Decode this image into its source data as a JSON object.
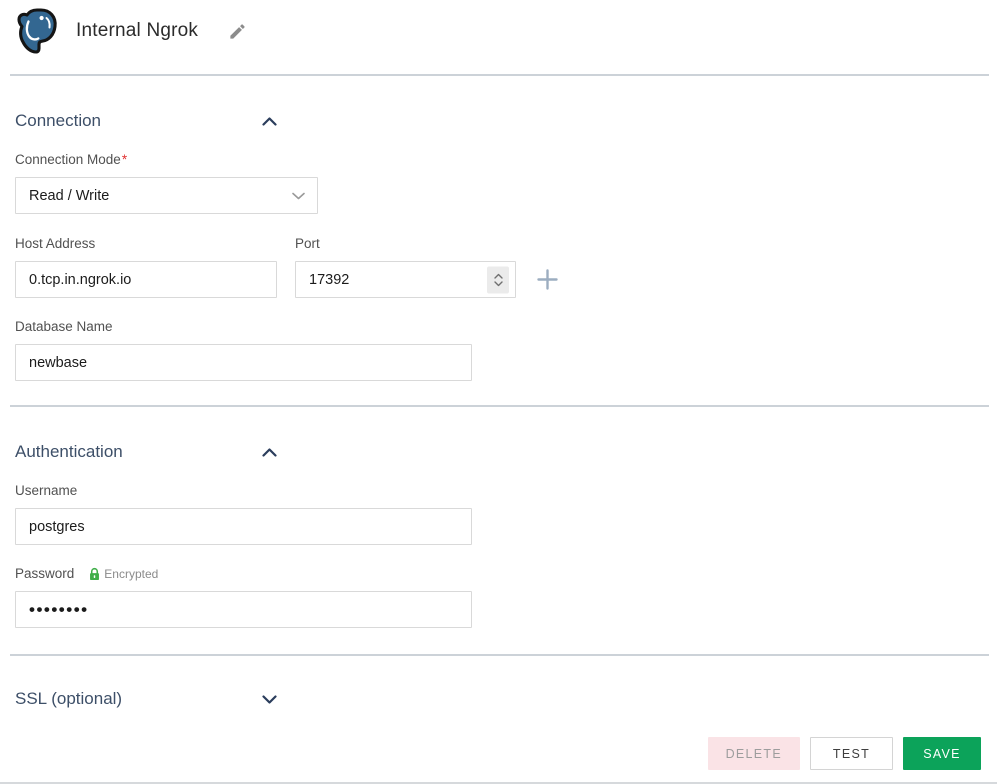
{
  "header": {
    "title": "Internal Ngrok"
  },
  "sections": {
    "connection": {
      "title": "Connection",
      "state": "expanded",
      "fields": {
        "connection_mode": {
          "label": "Connection Mode",
          "required_mark": "*",
          "value": "Read / Write"
        },
        "host_address": {
          "label": "Host Address",
          "value": "0.tcp.in.ngrok.io"
        },
        "port": {
          "label": "Port",
          "value": "17392"
        },
        "database_name": {
          "label": "Database Name",
          "value": "newbase"
        }
      }
    },
    "authentication": {
      "title": "Authentication",
      "state": "expanded",
      "fields": {
        "username": {
          "label": "Username",
          "value": "postgres"
        },
        "password": {
          "label": "Password",
          "badge": "Encrypted",
          "masked_value": "••••••••"
        }
      }
    },
    "ssl": {
      "title": "SSL (optional)",
      "state": "collapsed"
    }
  },
  "actions": {
    "delete_label": "DELETE",
    "test_label": "TEST",
    "save_label": "SAVE"
  },
  "icons": {
    "logo": "postgresql-elephant",
    "edit": "pencil-icon",
    "expanded": "chevron-up-icon",
    "collapsed": "chevron-down-icon",
    "add": "plus-icon",
    "encrypted": "lock-icon"
  },
  "colors": {
    "postgres_blue": "#336791",
    "section_heading": "#3d4f68",
    "required_red": "#e03131",
    "encrypted_green": "#3fae49",
    "save_green": "#0ca35a",
    "delete_bg": "#fae3e6",
    "delete_text": "#9d9d9d",
    "divider_gray": "#ccd2d8"
  }
}
